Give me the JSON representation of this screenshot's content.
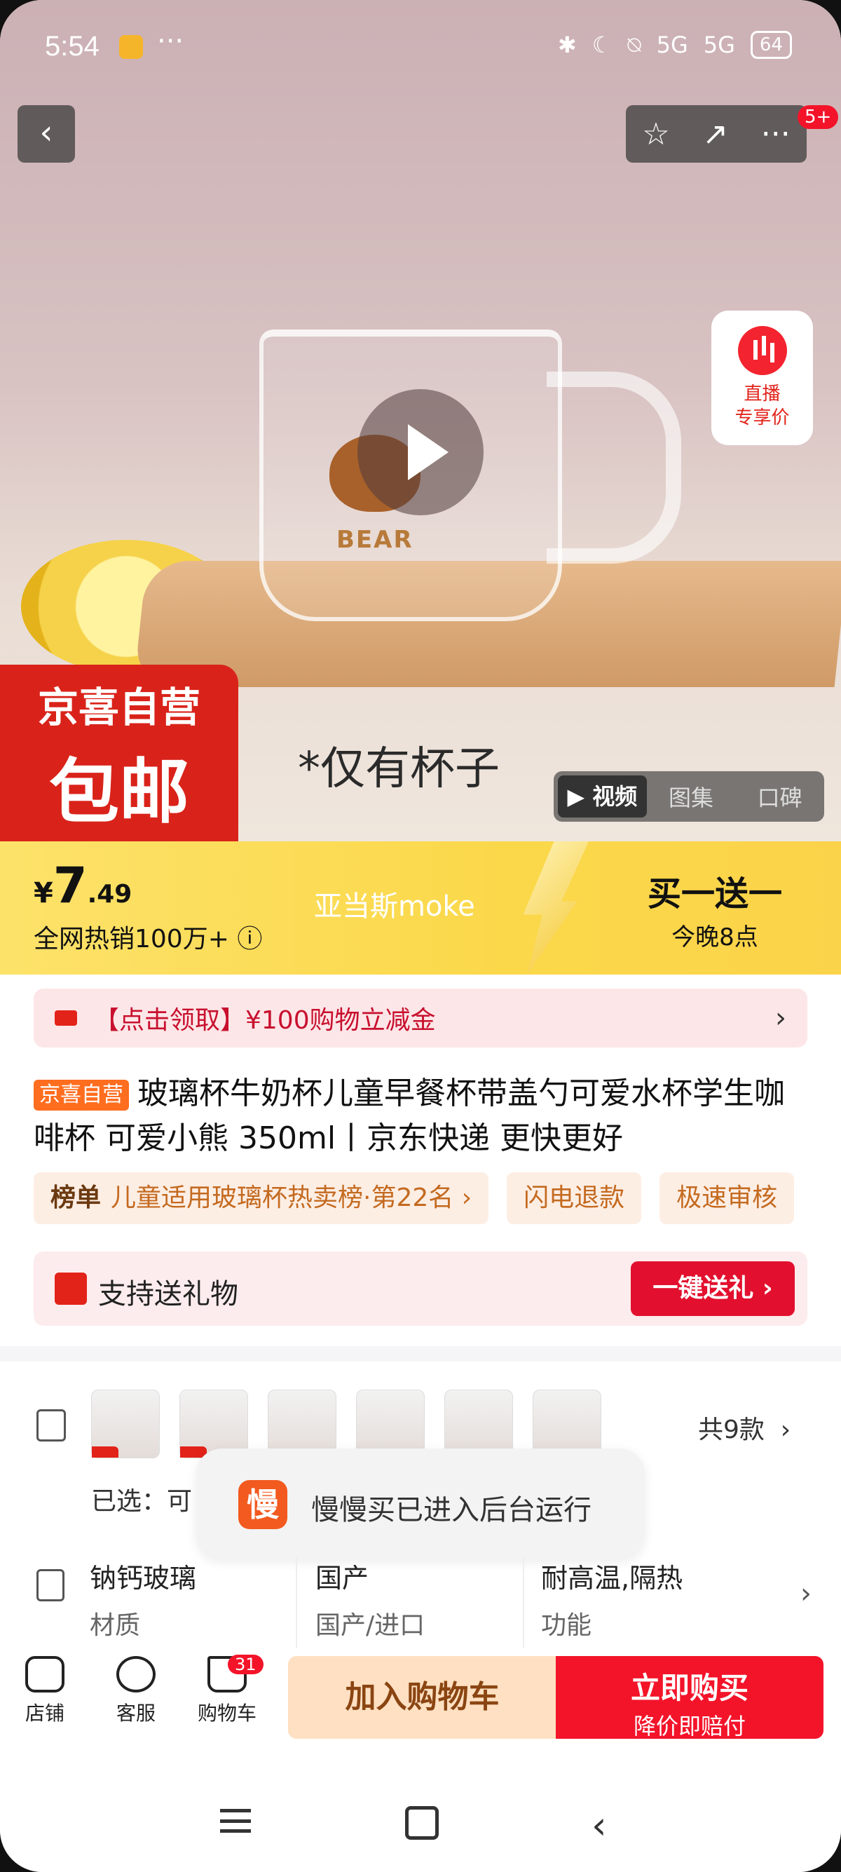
{
  "status_bar": {
    "time": "5:54",
    "dots": "···",
    "network1": "5G",
    "network2": "5G",
    "battery": "64"
  },
  "header": {
    "back": "‹",
    "star": "☆",
    "share": "↗",
    "more": "···",
    "badge": "5+"
  },
  "hero": {
    "caption": "*仅有杯子",
    "cup_text": "BEAR",
    "live": {
      "line1": "直播",
      "line2": "专享价"
    },
    "badge": {
      "line1": "京喜自营",
      "line2": "包邮"
    },
    "media_tabs": [
      "▶ 视频",
      "图集",
      "口碑"
    ]
  },
  "price_bar": {
    "currency": "¥",
    "price_int": "7",
    "price_dec": ".49",
    "sales": "全网热销100万+ ⓘ",
    "watermark": "亚当斯moke",
    "promo_title": "买一送一",
    "promo_time": "今晚8点"
  },
  "coupon": {
    "text": "【点击领取】¥100购物立减金",
    "arrow": "›"
  },
  "product": {
    "tag": "京喜自营",
    "title": "玻璃杯牛奶杯儿童早餐杯带盖勺可爱水杯学生咖啡杯 可爱小熊 350ml丨京东快递 更快更好"
  },
  "chips": [
    {
      "bold": "榜单",
      "text": "儿童适用玻璃杯热卖榜·第22名 ›"
    },
    {
      "bold": "",
      "text": "闪电退款"
    },
    {
      "bold": "",
      "text": "极速审核"
    }
  ],
  "gift": {
    "text": "支持送礼物",
    "button": "一键送礼 ›"
  },
  "variants": {
    "count": "共9款",
    "arrow": "›",
    "selected_label": "已选：可"
  },
  "toast": {
    "icon": "慢",
    "text": "慢慢买已进入后台运行"
  },
  "attributes": [
    {
      "value": "钠钙玻璃",
      "key": "材质"
    },
    {
      "value": "国产",
      "key": "国产/进口"
    },
    {
      "value": "耐高温,隔热",
      "key": "功能"
    }
  ],
  "bottom_bar": {
    "store": "店铺",
    "service": "客服",
    "cart": "购物车",
    "cart_count": "31",
    "add_cart": "加入购物车",
    "buy_now": "立即购买",
    "buy_now_sub": "降价即赔付"
  },
  "colors": {
    "brand_red": "#e2231a",
    "price_yellow": "#fbd84a",
    "add_cart_bg": "#ffe0c2"
  }
}
